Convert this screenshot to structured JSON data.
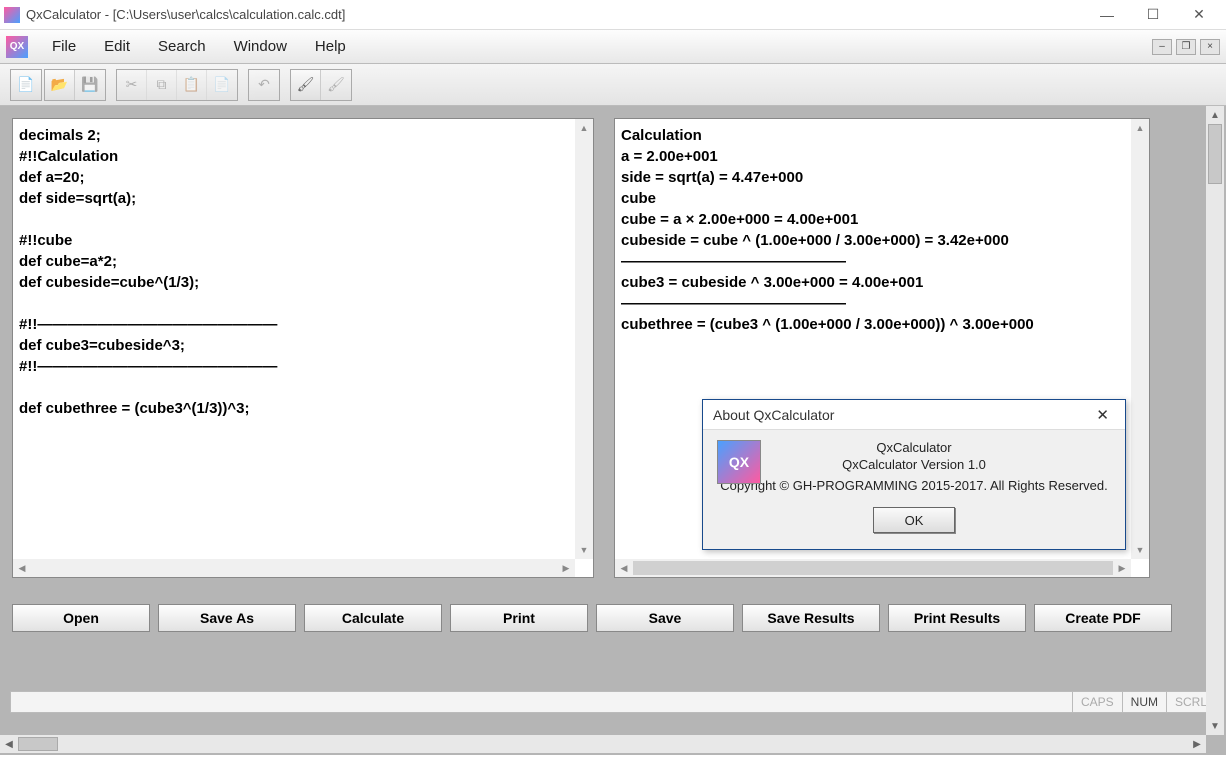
{
  "window": {
    "title": "QxCalculator - [C:\\Users\\user\\calcs\\calculation.calc.cdt]"
  },
  "menu": {
    "app_icon_text": "QX",
    "items": [
      "File",
      "Edit",
      "Search",
      "Window",
      "Help"
    ]
  },
  "editor": {
    "source": "decimals 2;\n#!!Calculation\ndef a=20;\ndef side=sqrt(a);\n\n#!!cube\ndef cube=a*2;\ndef cubeside=cube^(1/3);\n\n#!!————————————————\ndef cube3=cubeside^3;\n#!!————————————————\n\ndef cubethree = (cube3^(1/3))^3;"
  },
  "output": {
    "text": "Calculation\na = 2.00e+001\nside = sqrt(a) = 4.47e+000\ncube\ncube = a × 2.00e+000 = 4.00e+001\ncubeside = cube ^ (1.00e+000 / 3.00e+000) = 3.42e+000\n———————————————\ncube3 = cubeside ^ 3.00e+000 = 4.00e+001\n———————————————\ncubethree = (cube3 ^ (1.00e+000 / 3.00e+000)) ^ 3.00e+000"
  },
  "buttons": {
    "open": "Open",
    "save_as": "Save As",
    "calculate": "Calculate",
    "print": "Print",
    "save": "Save",
    "save_results": "Save Results",
    "print_results": "Print Results",
    "create_pdf": "Create PDF"
  },
  "status": {
    "caps": "CAPS",
    "num": "NUM",
    "scrl": "SCRL"
  },
  "dialog": {
    "title": "About QxCalculator",
    "icon_text": "QX",
    "line1": "QxCalculator",
    "line2": "QxCalculator Version 1.0",
    "line3": "Copyright © GH-PROGRAMMING 2015-2017. All Rights Reserved.",
    "ok": "OK"
  }
}
